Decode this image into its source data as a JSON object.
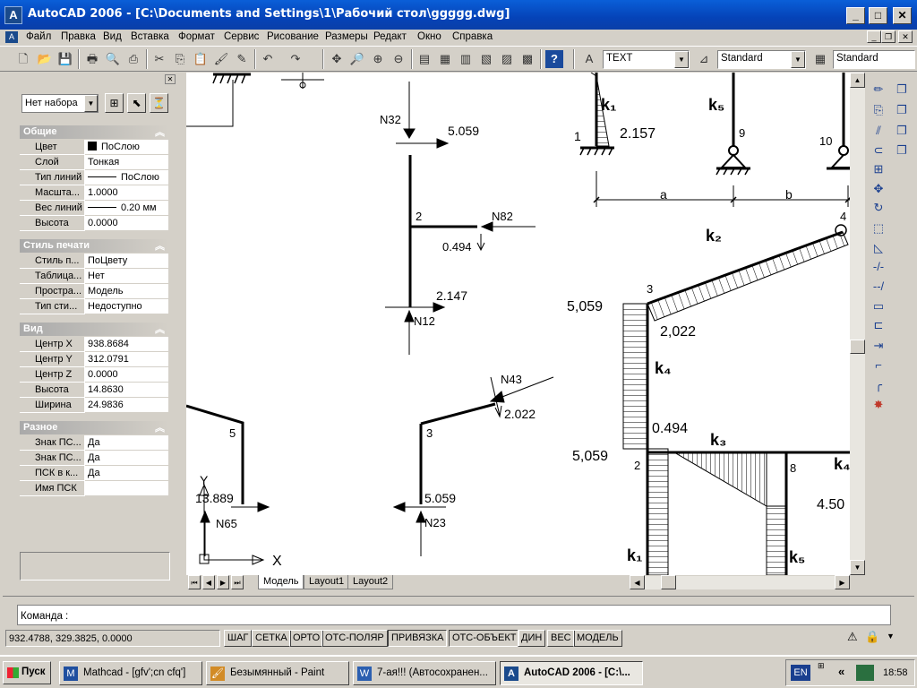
{
  "window": {
    "title": "AutoCAD 2006 - [C:\\Documents and Settings\\1\\Рабочий стол\\ggggg.dwg]",
    "icon": "autocad-icon"
  },
  "menu": [
    "Файл",
    "Правка",
    "Вид",
    "Вставка",
    "Формат",
    "Сервис",
    "Рисование",
    "Размеры",
    "Редакт",
    "Окно",
    "Справка"
  ],
  "toolbar": {
    "text_style": "TEXT",
    "dim_style": "Standard",
    "table_style": "Standard"
  },
  "properties": {
    "selection": "Нет набора",
    "sections": [
      {
        "title": "Общие",
        "rows": [
          [
            "Цвет",
            "ПоСлою"
          ],
          [
            "Слой",
            "Тонкая"
          ],
          [
            "Тип линий",
            "ПоСлою"
          ],
          [
            "Масшта...",
            "1.0000"
          ],
          [
            "Вес линий",
            "0.20 мм"
          ],
          [
            "Высота",
            "0.0000"
          ]
        ]
      },
      {
        "title": "Стиль печати",
        "rows": [
          [
            "Стиль п...",
            "ПоЦвету"
          ],
          [
            "Таблица...",
            "Нет"
          ],
          [
            "Простра...",
            "Модель"
          ],
          [
            "Тип сти...",
            "Недоступно"
          ]
        ]
      },
      {
        "title": "Вид",
        "rows": [
          [
            "Центр X",
            "938.8684"
          ],
          [
            "Центр Y",
            "312.0791"
          ],
          [
            "Центр Z",
            "0.0000"
          ],
          [
            "Высота",
            "14.8630"
          ],
          [
            "Ширина",
            "24.9836"
          ]
        ]
      },
      {
        "title": "Разное",
        "rows": [
          [
            "Знак ПС...",
            "Да"
          ],
          [
            "Знак ПС...",
            "Да"
          ],
          [
            "ПСК в к...",
            "Да"
          ],
          [
            "Имя ПСК",
            ""
          ]
        ]
      }
    ]
  },
  "drawing": {
    "labels": {
      "n32": "N32",
      "v5059a": "5.059",
      "n2": "2",
      "n82": "N82",
      "v0494a": "0.494",
      "v2147": "2.147",
      "n12": "N12",
      "n43": "N43",
      "v2022a": "2.022",
      "n3a": "3",
      "v5059b": "5.059",
      "n23": "N23",
      "n5": "5",
      "v13889": "13.889",
      "n65": "N65",
      "ucs_y": "Y",
      "ucs_x": "X",
      "k1a": "k₁",
      "v2157": "2.157",
      "n1": "1",
      "k5a": "k₅",
      "n9": "9",
      "n10": "10",
      "dim_a": "a",
      "dim_b": "b",
      "n4": "4",
      "k2": "k₂",
      "n3b": "3",
      "v5059c": "5,059",
      "v2022b": "2,022",
      "k4a": "k₄",
      "v0494b": "0.494",
      "k3": "k₃",
      "v5059d": "5,059",
      "n2b": "2",
      "n8": "8",
      "k4b": "k₄",
      "v450": "4.50",
      "k1b": "k₁",
      "k5b": "k₅"
    }
  },
  "tabs": [
    "Модель",
    "Layout1",
    "Layout2"
  ],
  "command": {
    "prompt": "Команда :"
  },
  "status": {
    "coords": "932.4788, 329.3825, 0.0000",
    "buttons": [
      "ШАГ",
      "СЕТКА",
      "ОРТО",
      "ОТС-ПОЛЯР",
      "ПРИВЯЗКА",
      "ОТС-ОБЪЕКТ",
      "ДИН",
      "ВЕС",
      "МОДЕЛЬ"
    ]
  },
  "taskbar": {
    "start": "Пуск",
    "tasks": [
      "Mathcad - [gfv';cn cfq']",
      "Безымянный - Paint",
      "7-ая!!! (Автосохранен...",
      "AutoCAD 2006 - [C:\\..."
    ],
    "lang": "EN",
    "clock": "18:58"
  }
}
